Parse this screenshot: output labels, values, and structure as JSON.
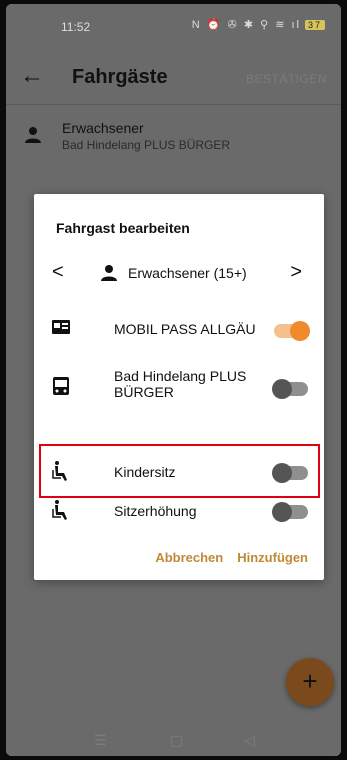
{
  "status_bar": {
    "time": "11:52",
    "signal_icons": "N ⏰ ✇ ✱ ⚲ ≋ ıl",
    "battery": "37"
  },
  "app_bar": {
    "back_icon": "arrow-left-icon",
    "title": "Fahrgäste",
    "confirm_label": "BESTÄTIGEN"
  },
  "passenger": {
    "name": "Erwachsener",
    "subtitle": "Bad Hindelang PLUS BÜRGER"
  },
  "dialog": {
    "title": "Fahrgast bearbeiten",
    "selector": {
      "label": "Erwachsener (15+)",
      "prev": "<",
      "next": ">"
    },
    "options": [
      {
        "label": "MOBIL PASS ALLGÄU",
        "icon": "id-card-icon",
        "enabled": true
      },
      {
        "label": "Bad Hindelang PLUS BÜRGER",
        "icon": "bus-icon",
        "enabled": false
      },
      {
        "label": "Kindersitz",
        "icon": "child-seat-icon",
        "enabled": false
      },
      {
        "label": "Sitzerhöhung",
        "icon": "booster-seat-icon",
        "enabled": false
      }
    ],
    "cancel_label": "Abbrechen",
    "add_label": "Hinzufügen"
  },
  "fab": {
    "label": "+"
  },
  "navbar": {
    "menu": "☰",
    "home": "▢",
    "back": "◁"
  },
  "colors": {
    "accent": "#f08a2a",
    "action_text": "#c08a35",
    "highlight": "#e00010",
    "scrim": "#6a6a6a"
  }
}
